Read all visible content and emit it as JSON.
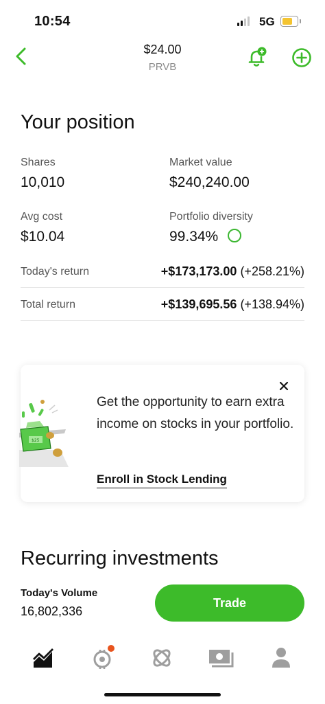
{
  "status_bar": {
    "time": "10:54",
    "network": "5G"
  },
  "nav": {
    "price": "$24.00",
    "ticker": "PRVB"
  },
  "position": {
    "title": "Your position",
    "shares_label": "Shares",
    "shares_value": "10,010",
    "market_value_label": "Market value",
    "market_value": "$240,240.00",
    "avg_cost_label": "Avg cost",
    "avg_cost_value": "$10.04",
    "diversity_label": "Portfolio diversity",
    "diversity_value": "99.34%",
    "todays_return_label": "Today's return",
    "todays_return_amount": "+$173,173.00",
    "todays_return_pct": "(+258.21%)",
    "total_return_label": "Total return",
    "total_return_amount": "+$139,695.56",
    "total_return_pct": "(+138.94%)"
  },
  "promo": {
    "text": "Get the opportunity to earn extra income on stocks in your portfolio.",
    "link": "Enroll in Stock Lending"
  },
  "recurring": {
    "title": "Recurring investments",
    "volume_label": "Today's Volume",
    "volume_value": "16,802,336",
    "trade_label": "Trade"
  },
  "tabs": [
    "chart-icon",
    "bitcoin-icon",
    "discover-icon",
    "money-icon",
    "profile-icon"
  ],
  "colors": {
    "accent": "#3dbb2a",
    "notify_dot": "#e8541e"
  }
}
